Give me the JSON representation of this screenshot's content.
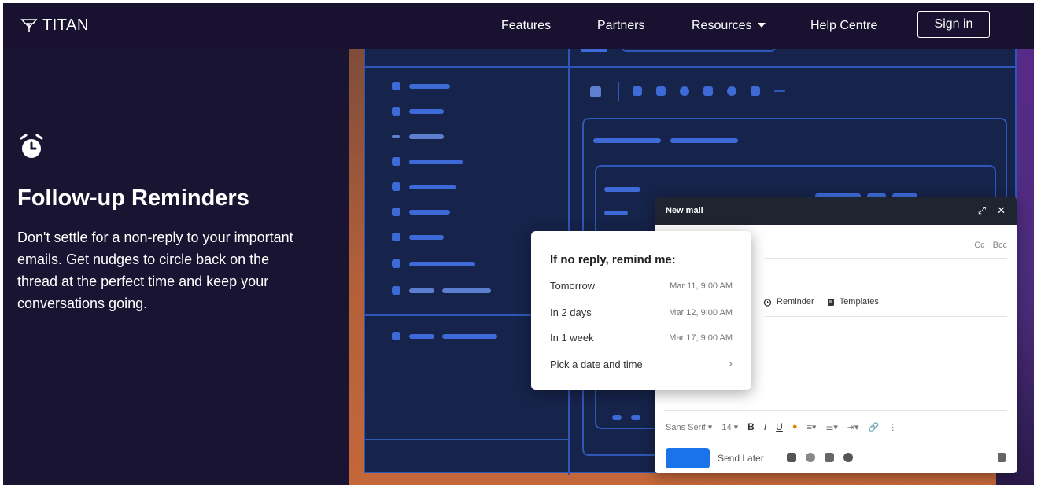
{
  "brand": {
    "name": "TITAN",
    "icon": "titan-logo-icon"
  },
  "nav": {
    "features": "Features",
    "partners": "Partners",
    "resources": "Resources",
    "help": "Help Centre",
    "signin": "Sign in"
  },
  "feature": {
    "icon": "alarm-clock-icon",
    "title": "Follow-up Reminders",
    "description": "Don't settle for a non-reply to your important emails. Get nudges to circle back on the thread at the perfect time and keep your conversations going."
  },
  "compose": {
    "title": "New mail",
    "cc": "Cc",
    "bcc": "Bcc",
    "reminder": "Reminder",
    "templates": "Templates",
    "font": "Sans Serif",
    "size": "14",
    "send_later": "Send Later"
  },
  "reminder_popup": {
    "title": "If no reply, remind me:",
    "options": [
      {
        "label": "Tomorrow",
        "time": "Mar 11, 9:00 AM"
      },
      {
        "label": "In 2 days",
        "time": "Mar 12, 9:00 AM"
      },
      {
        "label": "In 1 week",
        "time": "Mar 17, 9:00 AM"
      }
    ],
    "custom": "Pick a date and time"
  },
  "colors": {
    "background": "#1a1433",
    "nav": "#181230",
    "mockup_bg": "#16234a",
    "mockup_accent": "#3d6ad6",
    "send_button": "#1a73e8"
  }
}
